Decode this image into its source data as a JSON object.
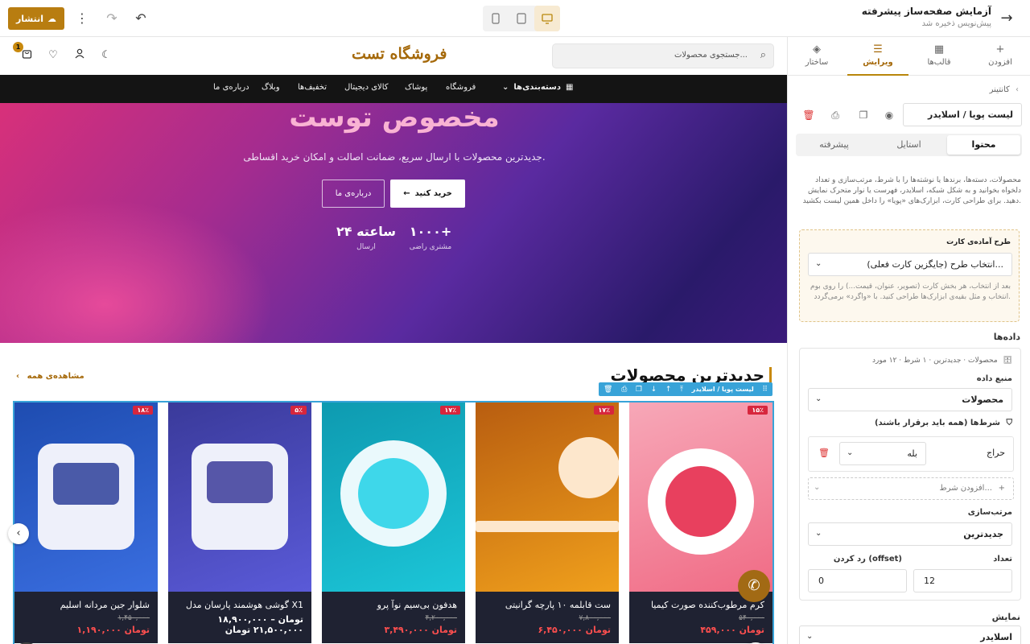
{
  "topbar": {
    "title": "آزمایش صفحه‌ساز پیشرفته",
    "status": "پیش‌نویس ذخیره شد",
    "publish_label": "انتشار",
    "icons": [
      "arrow-right-icon",
      "monitor-icon",
      "tablet-icon",
      "mobile-icon",
      "undo-icon",
      "redo-icon",
      "more-icon",
      "cloud-upload-icon"
    ],
    "accent": "#b87d10"
  },
  "store": {
    "logo": "فروشگاه تست",
    "search_placeholder": "جستجوی محصولات...",
    "cart_count": "1",
    "nav": {
      "categories": "دسته‌بندی‌ها",
      "items": [
        "فروشگاه",
        "پوشاک",
        "کالای دیجیتال",
        "تخفیف‌ها",
        "وبلاگ",
        "درباره‌ی ما"
      ]
    }
  },
  "hero": {
    "title": "مخصوص توست",
    "subtitle": "جدیدترین محصولات با ارسال سریع، ضمانت اصالت و امکان خرید اقساطی.",
    "buy_label": "خرید کنید",
    "about_label": "درباره‌ی ما",
    "stats": [
      {
        "value": "۱۰۰۰+",
        "label": "مشتری راضی"
      },
      {
        "value": "۲۴ ساعته",
        "label": "ارسال"
      }
    ]
  },
  "products": {
    "title": "جدیدترین محصولات",
    "see_all": "مشاهده‌ی همه",
    "widget_label": "لیست پویا / اسلایدر",
    "items": [
      {
        "name": "کرم مرطوب‌کننده صورت کیمیا",
        "old_price": "۵۴۰,۰۰۰",
        "price": "۴۵۹,۰۰۰ تومان",
        "discount": "۱۵٪"
      },
      {
        "name": "ست قابلمه ۱۰ پارچه گرانیتی",
        "old_price": "۷,۸۰۰,۰۰۰",
        "price": "۶,۴۵۰,۰۰۰ تومان",
        "discount": "۱۷٪"
      },
      {
        "name": "هدفون بی‌سیم نوآ پرو",
        "old_price": "۴,۲۰۰,۰۰۰",
        "price": "۳,۴۹۰,۰۰۰ تومان",
        "discount": "۱۷٪"
      },
      {
        "name": "گوشی هوشمند پارسان مدل X1",
        "old_price": "",
        "price": "۱۸,۹۰۰,۰۰۰ تومان – ۲۱,۵۰۰,۰۰۰ تومان",
        "discount": "۵٪"
      },
      {
        "name": "شلوار جین مردانه اسلیم",
        "old_price": "۱,۴۵۰,۰۰۰",
        "price": "۱,۱۹۰,۰۰۰ تومان",
        "discount": "۱۸٪"
      }
    ]
  },
  "panel": {
    "tabs": [
      "افزودن",
      "قالب‌ها",
      "ویرایش",
      "ساختار"
    ],
    "breadcrumb": "کانتینر",
    "element_name": "لیست پویا / اسلایدر",
    "subtabs": [
      "محتوا",
      "استایل",
      "پیشرفته"
    ],
    "description": "محصولات، دسته‌ها، برندها یا نوشته‌ها را با شرط، مرتب‌سازی و تعداد دلخواه بخوانید و به شکل شبکه، اسلایدر، فهرست یا نوار متحرک نمایش دهید. برای طراحی کارت، ابزارک‌های «پویا» را داخل همین لیست بکشید.",
    "template": {
      "title": "طرح آماده‌ی کارت",
      "select_value": "انتخاب طرح (جایگزین کارت فعلی)...",
      "hint": "بعد از انتخاب، هر بخش کارت (تصویر، عنوان، قیمت...) را روی بوم انتخاب و مثل بقیه‌ی ابزارک‌ها طراحی کنید. با «واگرد» برمی‌گردد."
    },
    "data": {
      "heading": "داده‌ها",
      "summary": "محصولات · جدیدترین · ۱ شرط · ۱۲ مورد",
      "source_label": "منبع داده",
      "source_value": "محصولات",
      "conditions_label": "شرط‌ها (همه باید برقرار باشند)",
      "condition_field": "حراج",
      "condition_value": "بله",
      "add_condition": "افزودن شرط...",
      "sort_label": "مرتب‌سازی",
      "sort_value": "جدیدترین",
      "count_label": "تعداد",
      "count_value": "12",
      "offset_label": "رد کردن (offset)",
      "offset_value": "0"
    },
    "display": {
      "heading": "نمایش",
      "value": "اسلایدر"
    }
  }
}
